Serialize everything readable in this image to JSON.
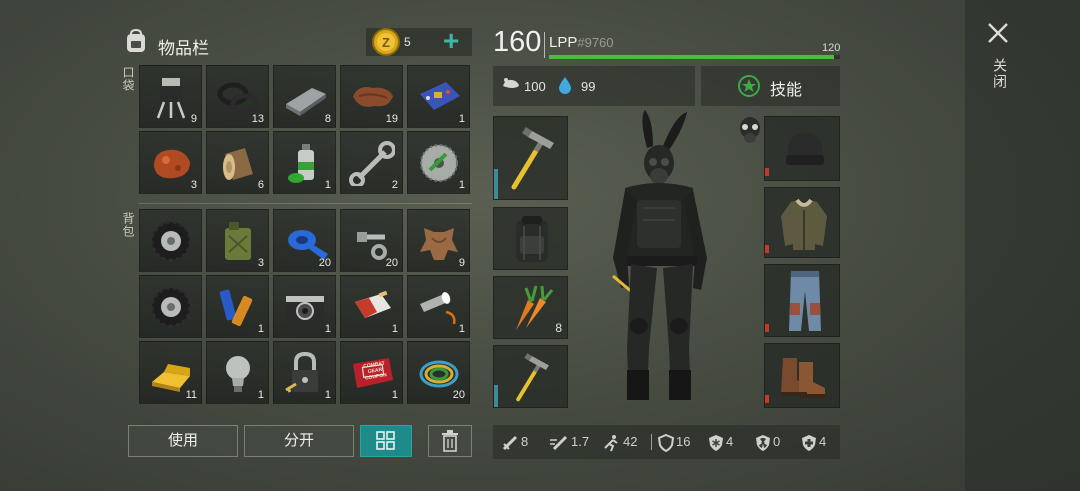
{
  "header": {
    "inventory_title": "物品栏",
    "coin_count": "5",
    "plus_label": "+",
    "level": "160",
    "player_name": "LPP",
    "player_id": "#9760",
    "xp_value": "120",
    "xp_progress": 0.98
  },
  "sections": {
    "pocket": "口袋",
    "backpack": "背包"
  },
  "pocket": [
    {
      "icon": "transistor-icon",
      "count": "9"
    },
    {
      "icon": "rubber-rings-icon",
      "count": "13"
    },
    {
      "icon": "metal-bar-icon",
      "count": "8"
    },
    {
      "icon": "leather-icon",
      "count": "19"
    },
    {
      "icon": "circuit-board-icon",
      "count": "1"
    },
    {
      "icon": "resin-icon",
      "count": "3"
    },
    {
      "icon": "log-icon",
      "count": "6"
    },
    {
      "icon": "spray-can-icon",
      "count": "1"
    },
    {
      "icon": "wrench-icon",
      "count": "2"
    },
    {
      "icon": "saw-blade-icon",
      "count": "1"
    }
  ],
  "backpack": [
    {
      "icon": "tire-icon",
      "count": ""
    },
    {
      "icon": "jerrycan-icon",
      "count": "3"
    },
    {
      "icon": "tape-icon",
      "count": "20"
    },
    {
      "icon": "bolts-icon",
      "count": "20"
    },
    {
      "icon": "animal-hide-icon",
      "count": "9"
    },
    {
      "icon": "tire-icon",
      "count": ""
    },
    {
      "icon": "batteries-icon",
      "count": "1"
    },
    {
      "icon": "camera-icon",
      "count": "1"
    },
    {
      "icon": "cigarettes-icon",
      "count": "1"
    },
    {
      "icon": "flashlight-icon",
      "count": "1"
    },
    {
      "icon": "gold-bar-icon",
      "count": "11"
    },
    {
      "icon": "light-bulb-icon",
      "count": "1"
    },
    {
      "icon": "padlock-icon",
      "count": "1"
    },
    {
      "icon": "coupon-icon",
      "count": "1"
    },
    {
      "icon": "wires-icon",
      "count": "20"
    }
  ],
  "coupon_text": "COMBAT GEAR COUPON",
  "buttons": {
    "use": "使用",
    "split": "分开"
  },
  "stats": {
    "food": "100",
    "water": "99",
    "skills": "技能"
  },
  "equipment": {
    "carrot_count": "8"
  },
  "bottom_stats": {
    "attack": "8",
    "attack_speed": "1.7",
    "move_speed": "42",
    "defense": "16",
    "cold_resist": "4",
    "radiation": "0",
    "bio": "4"
  },
  "close_label": "关闭",
  "colors": {
    "xp_bar": "#4dbb3d",
    "water": "#3fa9e0",
    "skills_icon": "#3ea84b",
    "bag_grid": "#1f8a8a"
  }
}
